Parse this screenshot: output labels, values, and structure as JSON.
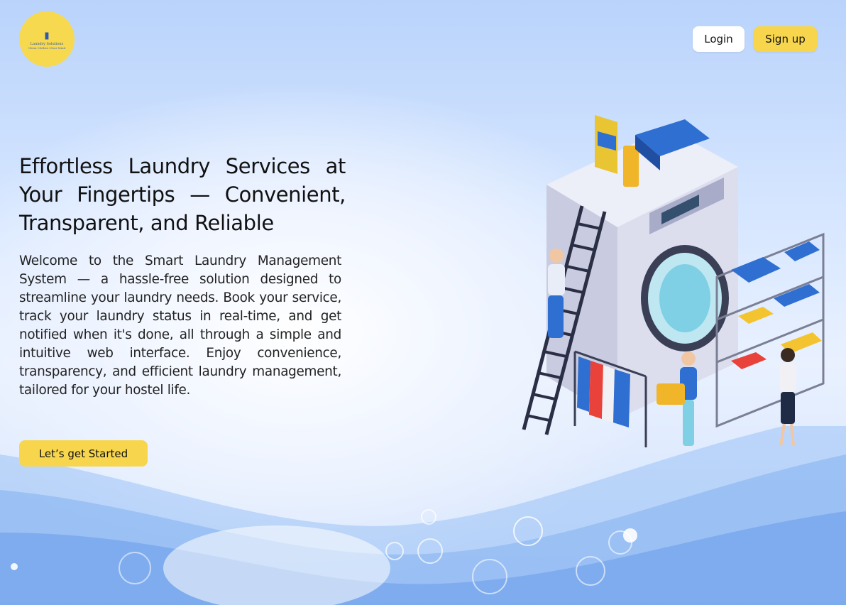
{
  "logo": {
    "name": "Laundry Solutions",
    "tagline": "Clean Clothes Clear Mind"
  },
  "nav": {
    "login_label": "Login",
    "signup_label": "Sign up"
  },
  "hero": {
    "heading": "Effortless Laundry Services at Your Fingertips — Convenient, Transparent, and Reliable",
    "description": "Welcome to the Smart Laundry Management System — a hassle-free solution designed to streamline your laundry needs. Book your service, track your laundry status in real-time, and get notified when it's done, all through a simple and intuitive web interface. Enjoy convenience, transparency, and efficient laundry management, tailored for your hostel life.",
    "cta_label": "Let’s get Started"
  },
  "illustration": {
    "icon": "laundry-illustration"
  },
  "colors": {
    "accent": "#f7d64e",
    "background": "#d6e6ff",
    "machine": "#dfe0ee",
    "blue": "#2f6fd1"
  }
}
